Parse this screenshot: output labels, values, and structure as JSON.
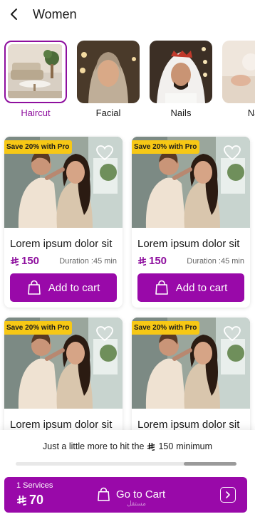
{
  "header": {
    "title": "Women"
  },
  "categories": [
    {
      "label": "Haircut",
      "active": true
    },
    {
      "label": "Facial",
      "active": false
    },
    {
      "label": "Nails",
      "active": false
    },
    {
      "label": "Na",
      "active": false
    }
  ],
  "products": [
    {
      "badge": "Save 20% with Pro",
      "title": "Lorem ipsum dolor sit",
      "price": "150",
      "duration": "Duration :45 min",
      "button": "Add to cart"
    },
    {
      "badge": "Save 20% with Pro",
      "title": "Lorem ipsum dolor sit",
      "price": "150",
      "duration": "Duration :45 min",
      "button": "Add to cart"
    },
    {
      "badge": "Save 20% with Pro",
      "title": "Lorem ipsum dolor sit",
      "price": "",
      "duration": "",
      "button": ""
    },
    {
      "badge": "Save 20% with Pro",
      "title": "Lorem ipsum dolor sit",
      "price": "",
      "duration": "",
      "button": ""
    }
  ],
  "cart_sheet": {
    "min_text_before": "Just a little more to hit the",
    "min_amount": "150",
    "min_text_after": "minimum",
    "progress": 0.55,
    "services_count": "1 Services",
    "total": "70",
    "goto_label": "Go to Cart",
    "watermark": "مستقل"
  },
  "colors": {
    "accent": "#9909a9",
    "badge": "#f7c815"
  },
  "icons": {
    "back": "chevron-left-icon",
    "heart": "heart-icon",
    "bag": "shopping-bag-icon",
    "arrow": "chevron-right-icon",
    "currency": "riyal-icon"
  }
}
